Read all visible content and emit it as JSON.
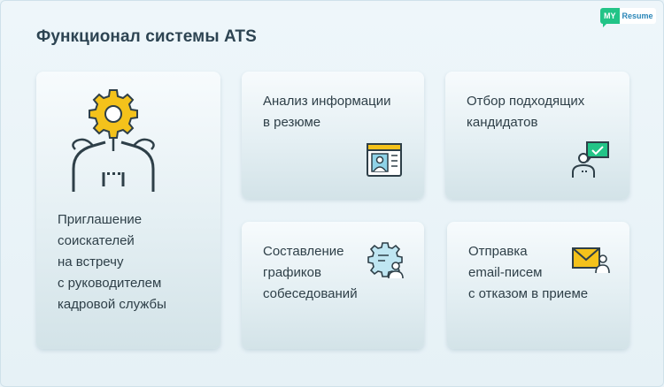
{
  "title": "Функционал системы  ATS",
  "logo": {
    "my": "MY",
    "resume": "Resume"
  },
  "cards": [
    {
      "text": "Приглашение\nсоискателей\nна встречу\nс руководителем\nкадровой службы"
    },
    {
      "text": "Анализ информации\nв резюме"
    },
    {
      "text": "Отбор подходящих\nкандидатов"
    },
    {
      "text": "Составление\nграфиков\nсобеседований"
    },
    {
      "text": "Отправка\nemail-писем\nс отказом в приеме"
    }
  ],
  "colors": {
    "accent_yellow": "#f4c21b",
    "accent_green": "#22c487",
    "line": "#2e3f48",
    "title": "#2d4452"
  },
  "icons": [
    "gear-head-person-icon",
    "resume-window-icon",
    "candidate-screen-icon",
    "gear-schedule-icon",
    "email-envelope-icon"
  ]
}
